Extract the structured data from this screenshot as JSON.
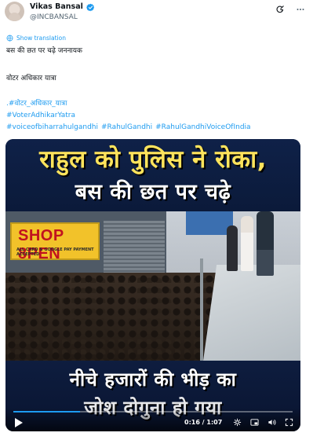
{
  "author": {
    "display_name": "Vikas Bansal",
    "handle": "@INCBANSAL"
  },
  "header": {
    "grok_icon": "grok-icon",
    "more_icon": "more-icon"
  },
  "translate": {
    "label": "Show translation",
    "icon": "globe-icon"
  },
  "tweet": {
    "line1": "बस की छत पर चढ़े जननायक",
    "line2": "वोटर अधिकार यात्रा",
    "line3": ".#वोटर_अधिकार_यात्रा",
    "line4": "#VoterAdhikarYatra",
    "hashtags_line5": [
      "#voiceofbiharrahulgandhi",
      "#RahulGandhi",
      "#RahulGandhiVoiceOfIndia"
    ]
  },
  "media": {
    "banner_top_line1": "राहुल को पुलिस ने रोका,",
    "banner_top_line2": "बस की छत पर चढ़े",
    "shop_sign": "SHOP 8PEN",
    "shop_sign_sub": "ALL CARD & GOOGLE PAY PAYMENT ACCEPTED",
    "banner_bottom_line1": "नीचे हजारों की भीड़ का",
    "banner_bottom_line2": "जोश दोगुना हो गया"
  },
  "video": {
    "current_time": "0:16",
    "duration": "1:07",
    "time_display": "0:16 / 1:07",
    "progress_fraction": 0.24,
    "icons": [
      "play-icon",
      "settings-icon",
      "pip-icon",
      "volume-icon",
      "fullscreen-icon"
    ]
  },
  "colors": {
    "link": "#1d9bf0",
    "verified": "#1d9bf0",
    "banner_yellow": "#ffe45c"
  }
}
